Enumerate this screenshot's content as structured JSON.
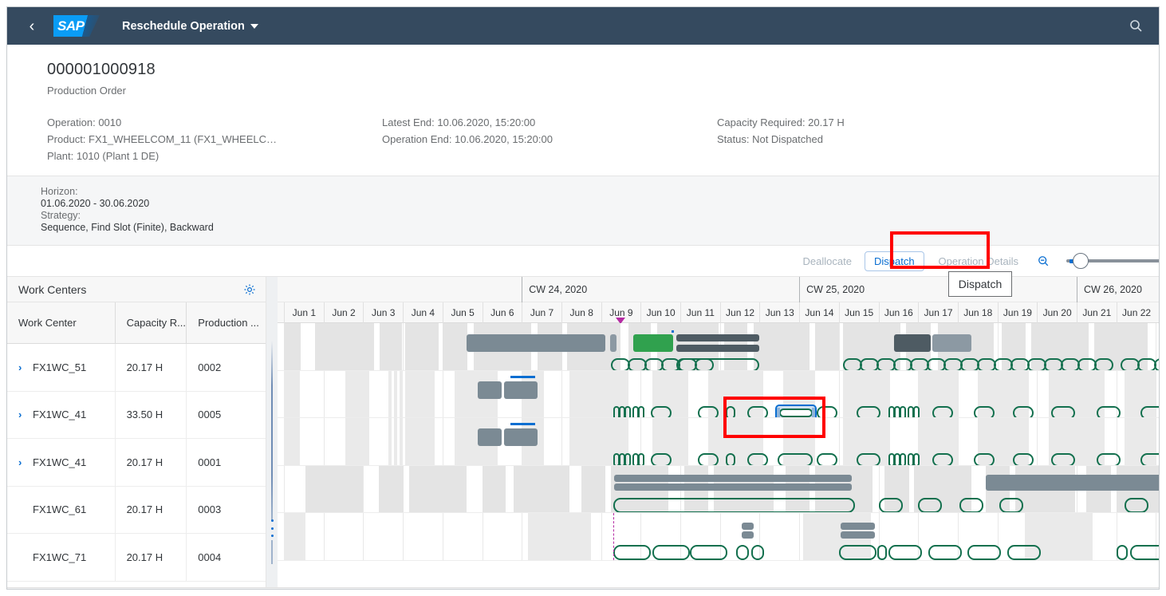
{
  "shellbar": {
    "back_icon": "chevron-left-icon",
    "logo": "SAP",
    "title": "Reschedule Operation",
    "search_icon": "search-icon"
  },
  "object_header": {
    "title": "000001000918",
    "subtitle": "Production Order",
    "facets": [
      {
        "lines": [
          "Operation: 0010",
          "Product: FX1_WHEELCOM_11 (FX1_WHEELC…",
          "Plant: 1010 (Plant 1 DE)"
        ]
      },
      {
        "lines": [
          "Latest End: 10.06.2020, 15:20:00",
          "Operation End: 10.06.2020, 15:20:00"
        ]
      },
      {
        "lines": [
          "Capacity Required: 20.17 H",
          "Status: Not Dispatched"
        ]
      }
    ]
  },
  "horizon": {
    "horizon_label": "Horizon:",
    "horizon_value": "01.06.2020 - 30.06.2020",
    "strategy_label": "Strategy:",
    "strategy_value": "Sequence, Find Slot (Finite), Backward"
  },
  "toolbar": {
    "deallocate_label": "Deallocate",
    "dispatch_label": "Dispatch",
    "operation_details_label": "Operation Details",
    "search_icon": "search-icon",
    "zoom_out_icon": "zoom-out-icon",
    "zoom_slider_value": "8"
  },
  "tooltip": {
    "text": "Dispatch"
  },
  "work_centers_panel": {
    "title": "Work Centers",
    "settings_icon": "gear-icon",
    "columns": [
      "Work Center",
      "Capacity R...",
      "Production ..."
    ],
    "rows": [
      {
        "expander": true,
        "work_center": "FX1WC_51",
        "capacity": "20.17 H",
        "production": "0002"
      },
      {
        "expander": true,
        "work_center": "FX1WC_41",
        "capacity": "33.50 H",
        "production": "0005"
      },
      {
        "expander": true,
        "work_center": "FX1WC_41",
        "capacity": "20.17 H",
        "production": "0001"
      },
      {
        "expander": false,
        "work_center": "FX1WC_61",
        "capacity": "20.17 H",
        "production": "0003"
      },
      {
        "expander": false,
        "work_center": "FX1WC_71",
        "capacity": "20.17 H",
        "production": "0004"
      }
    ]
  },
  "timeline": {
    "calendar_weeks": [
      "CW 24, 2020",
      "CW 25, 2020",
      "CW 26, 2020"
    ],
    "days": [
      "Jun 1",
      "Jun 2",
      "Jun 3",
      "Jun 4",
      "Jun 5",
      "Jun 6",
      "Jun 7",
      "Jun 8",
      "Jun 9",
      "Jun 10",
      "Jun 11",
      "Jun 12",
      "Jun 13",
      "Jun 14",
      "Jun 15",
      "Jun 16",
      "Jun 17",
      "Jun 18",
      "Jun 19",
      "Jun 20",
      "Jun 21",
      "Jun 22"
    ],
    "marker_day": "Jun 9",
    "marker_color": "#b52ba3"
  },
  "colors": {
    "shell_bg": "#354a5f",
    "accent": "#0a6ed1",
    "bar_gray": "#7b8a94",
    "bar_dark_gray": "#4e5b63",
    "bar_green": "#30a14e",
    "capsule_green": "#13704e",
    "annotation_red": "#ff0000"
  }
}
